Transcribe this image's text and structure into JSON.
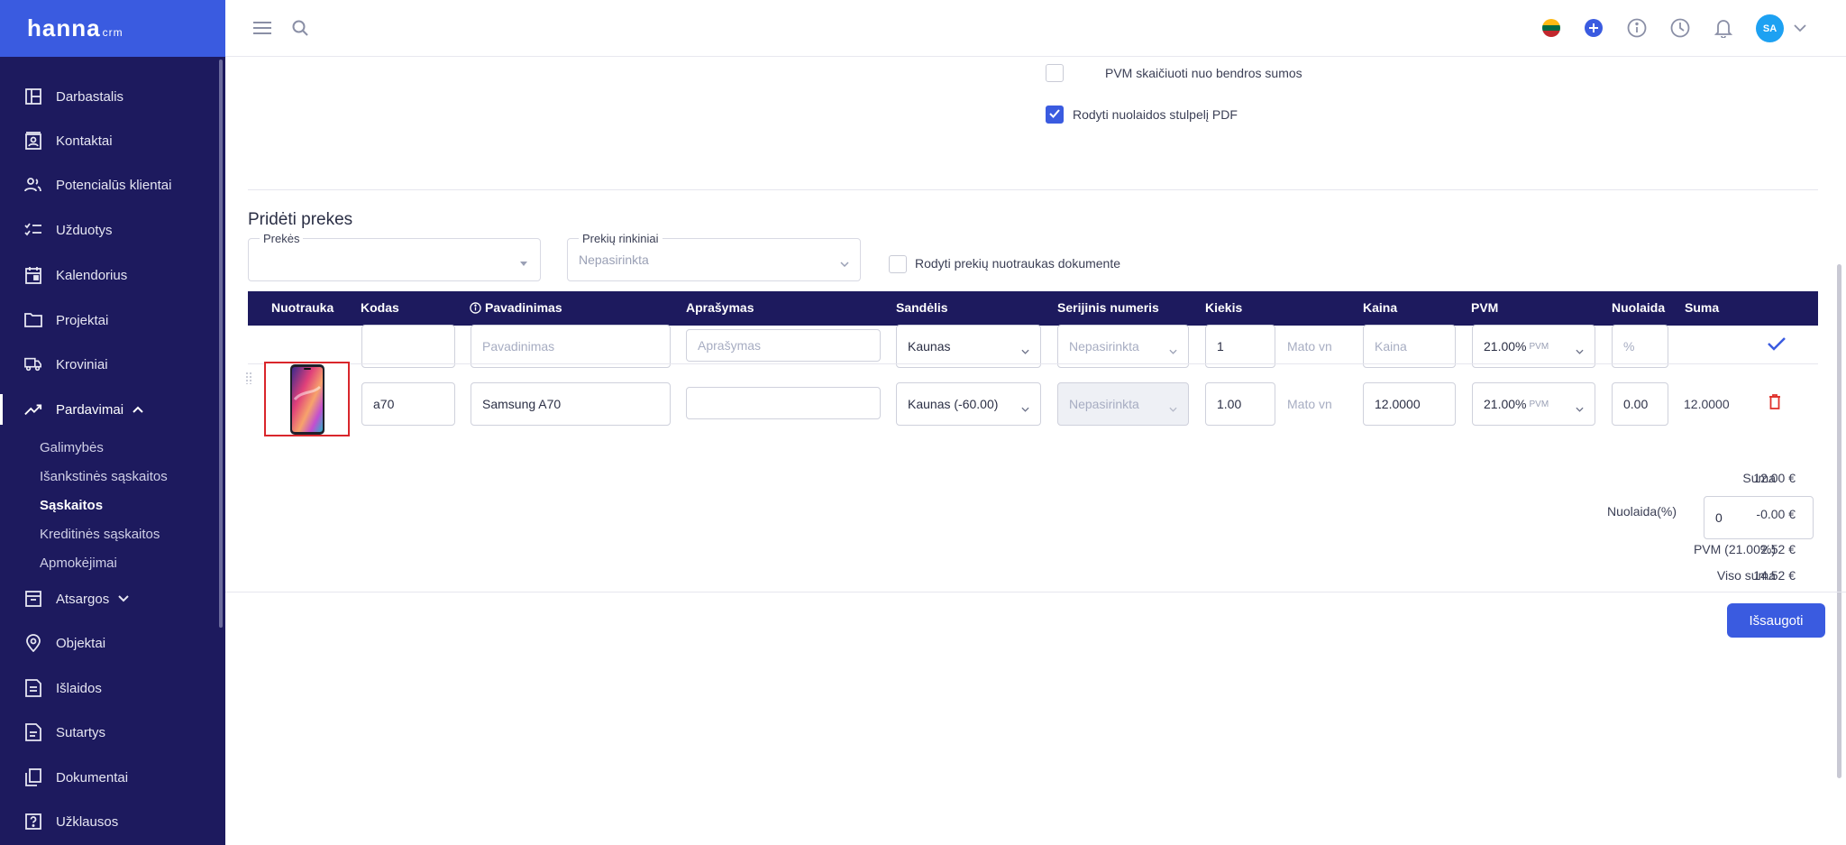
{
  "app": {
    "logo": "hanna",
    "logo_suffix": "crm"
  },
  "sidebar": {
    "items": [
      {
        "label": "Darbastalis",
        "icon": "dashboard-icon"
      },
      {
        "label": "Kontaktai",
        "icon": "contacts-icon"
      },
      {
        "label": "Potencialūs klientai",
        "icon": "leads-icon"
      },
      {
        "label": "Užduotys",
        "icon": "tasks-icon"
      },
      {
        "label": "Kalendorius",
        "icon": "calendar-icon"
      },
      {
        "label": "Projektai",
        "icon": "folder-icon"
      },
      {
        "label": "Kroviniai",
        "icon": "truck-icon"
      },
      {
        "label": "Pardavimai",
        "icon": "sales-chart-icon"
      },
      {
        "label": "Atsargos",
        "icon": "archive-icon"
      },
      {
        "label": "Objektai",
        "icon": "location-icon"
      },
      {
        "label": "Išlaidos",
        "icon": "expenses-icon"
      },
      {
        "label": "Sutartys",
        "icon": "contract-icon"
      },
      {
        "label": "Dokumentai",
        "icon": "documents-icon"
      },
      {
        "label": "Užklausos",
        "icon": "question-icon"
      }
    ],
    "sales_sub": [
      "Galimybės",
      "Išankstinės sąskaitos",
      "Sąskaitos",
      "Kreditinės sąskaitos",
      "Apmokėjimai"
    ]
  },
  "topbar": {
    "avatar": "SA"
  },
  "settings": {
    "pvm_total_label": "PVM skaičiuoti nuo bendros sumos",
    "discount_pdf_label": "Rodyti nuolaidos stulpelį PDF"
  },
  "add_products": {
    "title": "Pridėti prekes",
    "products_label": "Prekės",
    "products_value": "",
    "sets_label": "Prekių rinkiniai",
    "sets_value": "Nepasirinkta",
    "show_photos_label": "Rodyti prekių nuotraukas dokumente"
  },
  "table": {
    "headers": {
      "photo": "Nuotrauka",
      "code": "Kodas",
      "name": "Pavadinimas",
      "description": "Aprašymas",
      "warehouse": "Sandėlis",
      "serial": "Serijinis numeris",
      "quantity": "Kiekis",
      "price": "Kaina",
      "vat": "PVM",
      "discount": "Nuolaida",
      "sum": "Suma"
    },
    "new_row": {
      "code": "",
      "name_ph": "Pavadinimas",
      "desc_ph": "Aprašymas",
      "warehouse": "Kaunas",
      "serial": "Nepasirinkta",
      "quantity": "1",
      "unit": "Mato vn",
      "price_ph": "Kaina",
      "vat": "21.00%",
      "vat_suffix": "PVM",
      "discount_ph": "%"
    },
    "item_row": {
      "code": "a70",
      "name": "Samsung A70",
      "description": "",
      "warehouse": "Kaunas (-60.00)",
      "serial": "Nepasirinkta",
      "quantity": "1.00",
      "unit": "Mato vn",
      "price": "12.0000",
      "vat": "21.00%",
      "vat_suffix": "PVM",
      "discount": "0.00",
      "sum": "12.0000"
    }
  },
  "totals": {
    "sum_label": "Suma",
    "sum_value": "12.00 €",
    "discount_label": "Nuolaida(%)",
    "discount_input": "0",
    "discount_value": "-0.00 €",
    "vat_label": "PVM (21.00%)",
    "vat_value": "2.52 €",
    "total_label": "Viso suma",
    "total_value": "14.52 €"
  },
  "save_label": "Išsaugoti",
  "colors": {
    "accent": "#3a5be0",
    "sidebar": "#1d1a5e",
    "danger": "#e0322c"
  }
}
